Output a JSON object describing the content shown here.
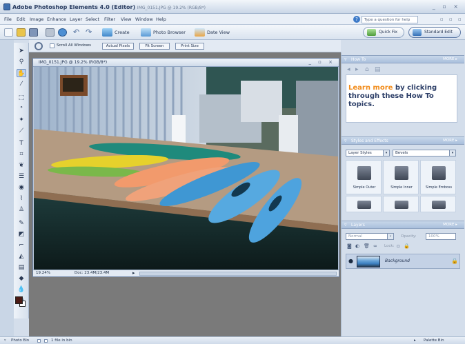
{
  "app": {
    "title": "Adobe Photoshop Elements 4.0 (Editor)",
    "title_suffix": "IMG_0151.JPG @ 19.2% (RGB/8*)",
    "window_controls": "_ ▫ ×"
  },
  "menu": {
    "items": [
      "File",
      "Edit",
      "Image",
      "Enhance",
      "Layer",
      "Select",
      "Filter",
      "View",
      "Window",
      "Help"
    ],
    "help_placeholder": "Type a question for help",
    "right_controls": "▫ ▫ ▫"
  },
  "toolbar": {
    "create_label": "Create",
    "photo_browser_label": "Photo Browser",
    "date_view_label": "Date View",
    "quick_fix_label": "Quick Fix",
    "standard_edit_label": "Standard Edit"
  },
  "options_bar": {
    "scroll_all_label": "Scroll All Windows",
    "actual_pixels_label": "Actual Pixels",
    "fit_screen_label": "Fit Screen",
    "print_size_label": "Print Size"
  },
  "document": {
    "title": "IMG_0151.JPG @ 19.2% (RGB/8*)",
    "window_controls": "_ ▫ ×",
    "zoom": "19.24%",
    "doc_info": "Doc: 23.4M/23.4M"
  },
  "palettes": {
    "how_to": {
      "title": "How To",
      "more_label": "MORE ▸",
      "learn_more": "Learn more",
      "body_text": " by clicking through these How To topics."
    },
    "styles": {
      "title": "Styles and Effects",
      "more_label": "MORE ▸",
      "category": "Layer Styles",
      "subcategory": "Bevels",
      "items": [
        "Simple Outer",
        "Simple Inner",
        "Simple Emboss"
      ]
    },
    "layers": {
      "title": "Layers",
      "more_label": "MORE ▸",
      "blend_mode": "Normal",
      "opacity_label": "Opacity:",
      "opacity_value": "100%",
      "lock_label": "Lock:",
      "layer_name": "Background"
    }
  },
  "status_bar": {
    "photo_bin_label": "Photo Bin",
    "files_in_bin": "1 file in bin",
    "palette_bin_label": "Palette Bin"
  },
  "colors": {
    "accent": "#3f6fae",
    "palette_header": "#a9bfdc",
    "learn_more": "#f28c1b"
  }
}
